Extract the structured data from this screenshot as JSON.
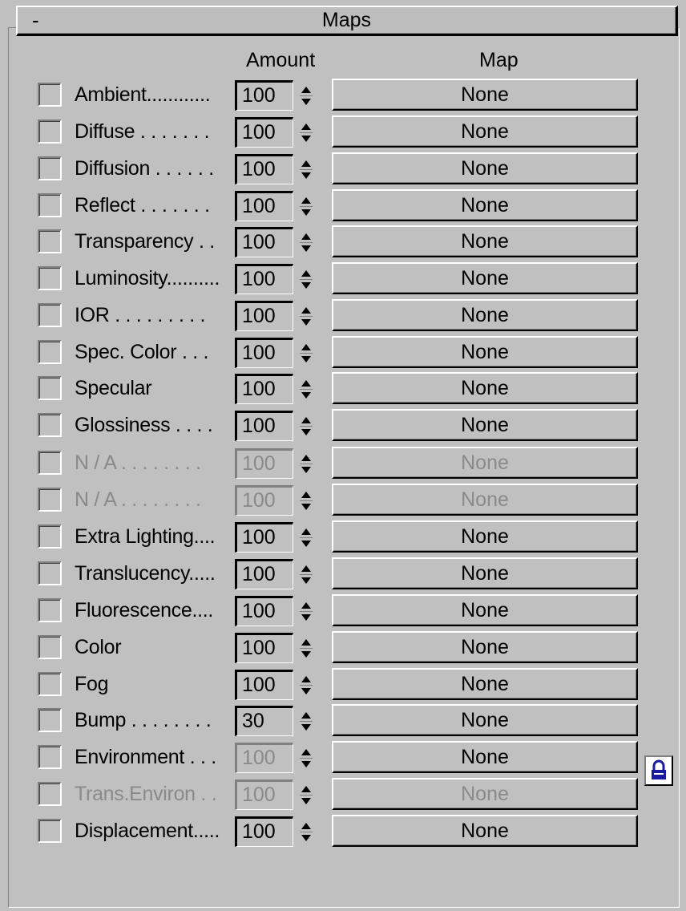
{
  "rollout": {
    "title": "Maps",
    "collapse_symbol": "-"
  },
  "columns": {
    "amount": "Amount",
    "map": "Map"
  },
  "rows": [
    {
      "label": "Ambient............",
      "amount": "100",
      "map": "None"
    },
    {
      "label": "Diffuse . . . . . . .",
      "amount": "100",
      "map": "None"
    },
    {
      "label": "Diffusion . . . . . .",
      "amount": "100",
      "map": "None"
    },
    {
      "label": "Reflect . . . . . . .",
      "amount": "100",
      "map": "None"
    },
    {
      "label": "Transparency . .",
      "amount": "100",
      "map": "None"
    },
    {
      "label": "Luminosity..........",
      "amount": "100",
      "map": "None"
    },
    {
      "label": "IOR . . . . . . . . .",
      "amount": "100",
      "map": "None"
    },
    {
      "label": "Spec. Color . . .",
      "amount": "100",
      "map": "None"
    },
    {
      "label": "Specular",
      "amount": "100",
      "map": "None"
    },
    {
      "label": "Glossiness . . . .",
      "amount": "100",
      "map": "None"
    },
    {
      "label": "N / A . . . . . . . .",
      "amount": "100",
      "map": "None"
    },
    {
      "label": "N / A . . . . . . . .",
      "amount": "100",
      "map": "None"
    },
    {
      "label": "Extra Lighting....",
      "amount": "100",
      "map": "None"
    },
    {
      "label": "Translucency.....",
      "amount": "100",
      "map": "None"
    },
    {
      "label": "Fluorescence....",
      "amount": "100",
      "map": "None"
    },
    {
      "label": "Color",
      "amount": "100",
      "map": "None"
    },
    {
      "label": "Fog",
      "amount": "100",
      "map": "None"
    },
    {
      "label": "Bump . . . . . . . .",
      "amount": "30",
      "map": "None"
    },
    {
      "label": "Environment . . .",
      "amount": "100",
      "map": "None"
    },
    {
      "label": "Trans.Environ . .",
      "amount": "100",
      "map": "None"
    },
    {
      "label": "Displacement.....",
      "amount": "100",
      "map": "None"
    }
  ],
  "lock_icon": "padlock-icon",
  "colors": {
    "panel": "#c0c0c0",
    "disabled_text": "#8a8a8a",
    "lock": "#1a1aa0"
  }
}
